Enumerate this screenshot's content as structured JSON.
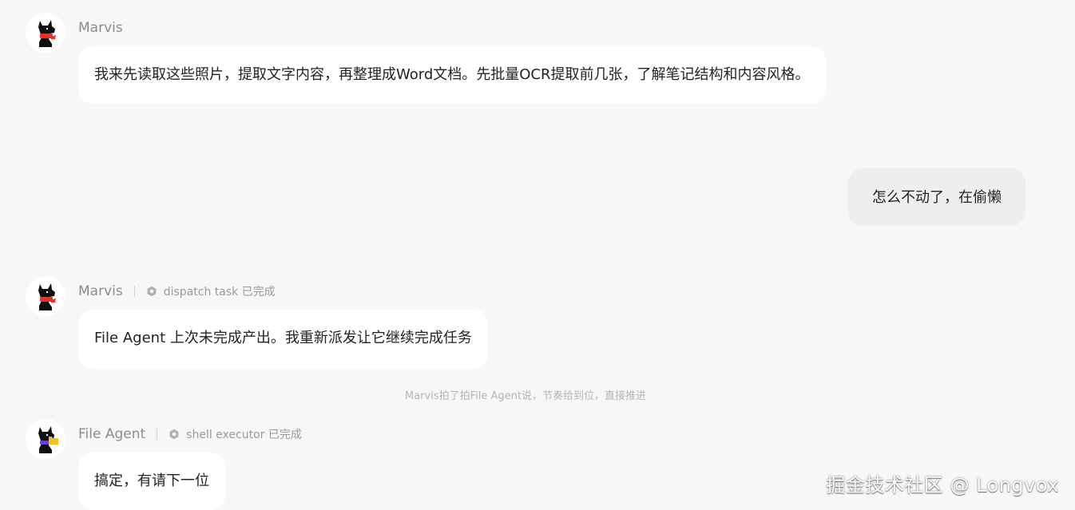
{
  "messages": [
    {
      "sender": "Marvis",
      "text": "我来先读取这些照片，提取文字内容，再整理成Word文档。先批量OCR提取前几张，了解笔记结构和内容风格。"
    },
    {
      "sender": "user",
      "text": "怎么不动了，在偷懒"
    },
    {
      "sender": "Marvis",
      "task": "dispatch task 已完成",
      "text": "File Agent 上次未完成产出。我重新派发让它继续完成任务"
    },
    {
      "system_note": "Marvis拍了拍File Agent说，节奏给到位，直接推进"
    },
    {
      "sender": "File Agent",
      "task": "shell executor 已完成",
      "text": "搞定，有请下一位"
    }
  ],
  "watermark": "掘金技术社区 @ Longvox",
  "icons": {
    "marvis_avatar": "black-dog-red-scarf-icon",
    "file_agent_avatar": "black-dog-yellow-folder-icon",
    "task_status": "hexagon-check-icon"
  },
  "colors": {
    "background": "#f7f7f7",
    "bubble": "#ffffff",
    "user_bubble": "#f0eeec",
    "scarf_red": "#e0352b",
    "folder_yellow": "#f2c31b",
    "scarf_purple": "#6b3fd1"
  }
}
